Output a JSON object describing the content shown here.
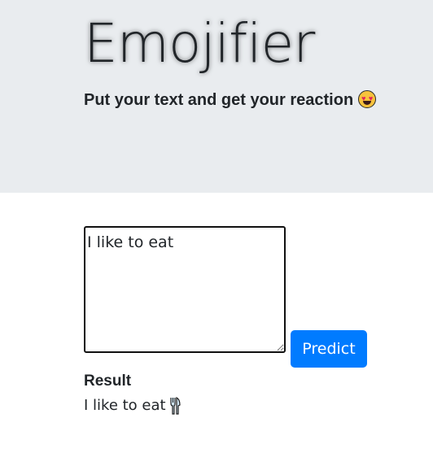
{
  "header": {
    "title": "Emojifier",
    "subtitle": "Put your text and get your reaction",
    "subtitle_emoji": "heart-eyes-face-icon"
  },
  "form": {
    "input_value": "I like to eat",
    "predict_label": "Predict"
  },
  "result": {
    "label": "Result",
    "text": "I like to eat",
    "emoji": "fork-and-knife-icon"
  },
  "colors": {
    "hero_background": "#e9ecef",
    "button_primary": "#007bff"
  }
}
